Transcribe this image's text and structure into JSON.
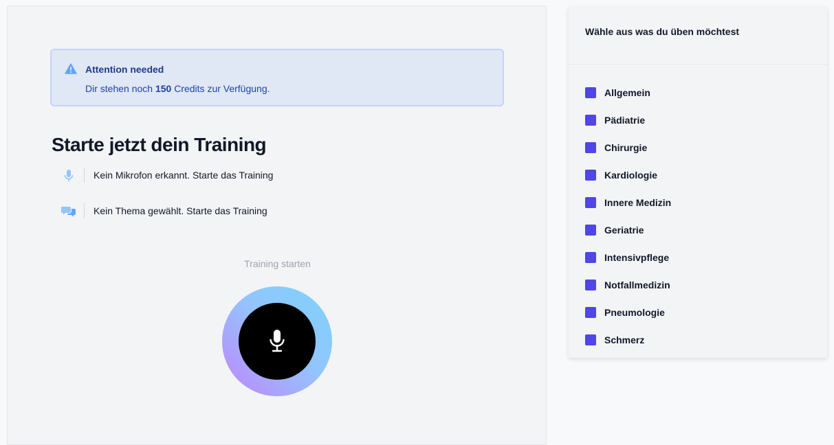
{
  "alert": {
    "title": "Attention needed",
    "text_prefix": "Dir stehen noch",
    "credits": "150",
    "text_suffix": "Credits zur Verfügung."
  },
  "page": {
    "title": "Starte jetzt dein Training"
  },
  "status": [
    {
      "icon": "microphone-icon",
      "text": "Kein Mikrofon erkannt. Starte das Training"
    },
    {
      "icon": "chat-bubbles-icon",
      "text": "Kein Thema gewählt. Starte das Training"
    }
  ],
  "training": {
    "start_label": "Training starten"
  },
  "sidebar": {
    "title": "Wähle aus was du üben möchtest",
    "topics": [
      "Allgemein",
      "Pädiatrie",
      "Chirurgie",
      "Kardiologie",
      "Innere Medizin",
      "Geriatrie",
      "Intensivpflege",
      "Notfallmedizin",
      "Pneumologie",
      "Schmerz"
    ]
  },
  "colors": {
    "accent": "#4f46e5",
    "alert_bg": "#e0e7f5",
    "alert_icon": "#60a5fa"
  }
}
